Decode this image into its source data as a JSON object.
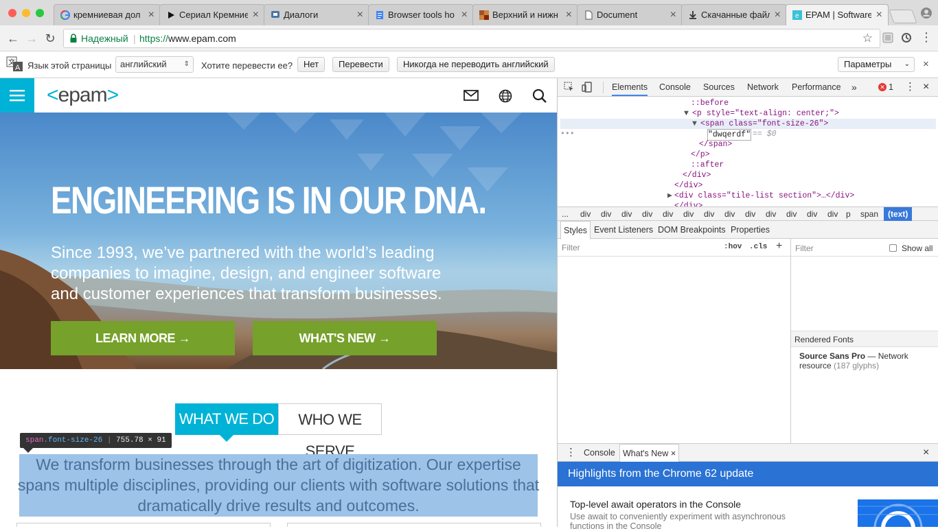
{
  "tabs": [
    {
      "title": "кремниевая дол",
      "icon": "google-icon"
    },
    {
      "title": "Сериал Кремние",
      "icon": "play-icon"
    },
    {
      "title": "Диалоги",
      "icon": "chat-icon"
    },
    {
      "title": "Browser tools ho",
      "icon": "doc-icon"
    },
    {
      "title": "Верхний и нижн",
      "icon": "grid-icon"
    },
    {
      "title": "Document",
      "icon": "page-icon"
    },
    {
      "title": "Скачанные файл",
      "icon": "download-icon"
    },
    {
      "title": "EPAM | Software",
      "icon": "epam-icon"
    }
  ],
  "omnibox": {
    "secure_label": "Надежный",
    "url_scheme": "https://",
    "url_host": "www.epam.com"
  },
  "translate": {
    "lang_label": "Язык этой страницы",
    "lang_value": "английский",
    "question": "Хотите перевести ее?",
    "no": "Нет",
    "translate": "Перевести",
    "never": "Никогда не переводить английский",
    "options": "Параметры"
  },
  "site": {
    "logo": "<epam>",
    "hero_title": "ENGINEERING IS IN OUR DNA.",
    "hero_text": "Since 1993, we’ve partnered with the world’s leading companies to imagine, design, and engineer software and customer experiences that transform businesses.",
    "learn_more": "LEARN MORE →",
    "whats_new": "WHAT'S NEW →",
    "tab_what": "WHAT WE DO",
    "tab_who": "WHO WE SERVE",
    "paragraph": "We transform businesses through the art of digitization. Our expertise spans multiple disciplines, providing our clients with software solutions that dramatically drive results and outcomes.",
    "tooltip_tag": "span",
    "tooltip_class": ".font-size-26",
    "tooltip_size": "755.78 × 91",
    "accent": "#00b3d6",
    "green": "#76a12b"
  },
  "devtools": {
    "tabs": [
      "Elements",
      "Console",
      "Sources",
      "Network",
      "Performance"
    ],
    "more": "»",
    "error_count": "1",
    "dom": [
      {
        "text": "::before"
      },
      {
        "text": "<p style=\"text-align: center;\">"
      },
      {
        "text": "<span class=\"font-size-26\">"
      },
      {
        "text": "\"dwqerdf\""
      },
      {
        "text": "== $0"
      },
      {
        "text": "</span>"
      },
      {
        "text": "</p>"
      },
      {
        "text": "::after"
      },
      {
        "text": "</div>"
      },
      {
        "text": "</div>"
      },
      {
        "text": "<div class=\"tile-list section\">…</div>"
      },
      {
        "text": "</div>"
      }
    ],
    "breadcrumbs": [
      "...",
      "div",
      "div",
      "div",
      "div",
      "div",
      "div",
      "div",
      "div",
      "div",
      "div",
      "div",
      "div",
      "div",
      "p",
      "span",
      "(text)"
    ],
    "subtabs": [
      "Styles",
      "Event Listeners",
      "DOM Breakpoints",
      "Properties"
    ],
    "filter": "Filter",
    "hov": ":hov",
    "cls": ".cls",
    "plus": "+",
    "filter2": "Filter",
    "show_all": "Show all",
    "rendered_fonts": "Rendered Fonts",
    "font_name": "Source Sans Pro",
    "font_dash": "—",
    "font_source": "Network resource",
    "font_glyphs": "(187 glyphs)",
    "drawer_console": "Console",
    "drawer_whatsnew": "What's New",
    "highlight": "Highlights from the Chrome 62 update",
    "feature_title": "Top-level await operators in the Console",
    "feature_text": "Use await to conveniently experiment with asynchronous functions in the Console"
  }
}
